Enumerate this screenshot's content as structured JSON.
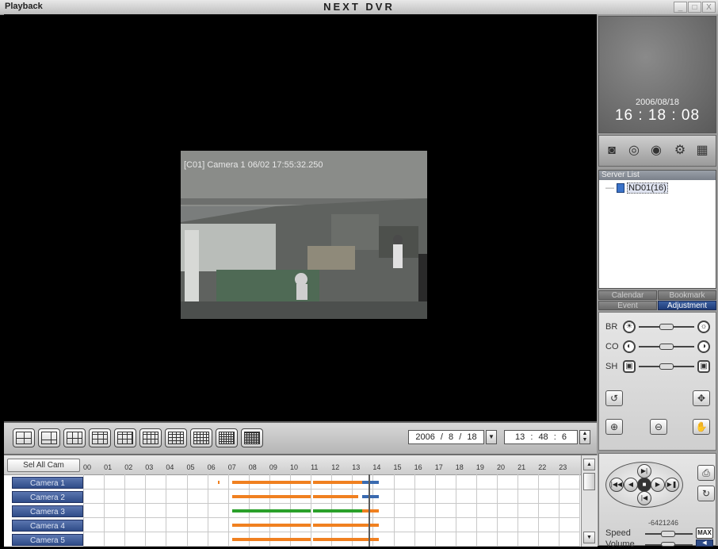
{
  "window": {
    "app_label": "Playback",
    "title": "NEXT DVR",
    "buttons": {
      "minimize": "_",
      "maximize": "□",
      "close": "X"
    }
  },
  "video": {
    "osd_text": "[C01] Camera 1 06/02 17:55:32.250"
  },
  "clock": {
    "date": "2006/08/18",
    "time": "16 : 18 : 08"
  },
  "toolbar_icons": [
    "camera-icon",
    "disk-icon",
    "disc-icon",
    "gear-icon",
    "film-icon"
  ],
  "server_list": {
    "header": "Server List",
    "items": [
      {
        "label": "ND01(16)"
      }
    ]
  },
  "tabs": {
    "calendar": "Calendar",
    "bookmark": "Bookmark",
    "event": "Event",
    "adjustment": "Adjustment",
    "active": "Adjustment"
  },
  "adjustment": {
    "rows": [
      {
        "label": "BR",
        "level": 0.5
      },
      {
        "label": "CO",
        "level": 0.5
      },
      {
        "label": "SH",
        "level": 0.5
      }
    ]
  },
  "playback": {
    "speed_label": "Speed",
    "speed_scale": "-6421246",
    "volume_label": "Volume",
    "max_label": "MAX"
  },
  "date_time_picker": {
    "year": "2006",
    "month": "8",
    "day": "18",
    "hour": "13",
    "minute": "48",
    "second": "6",
    "date_sep": "/",
    "time_sep": ":"
  },
  "timeline": {
    "select_all_label": "Sel All Cam",
    "hours": [
      "00",
      "01",
      "02",
      "03",
      "04",
      "05",
      "06",
      "07",
      "08",
      "09",
      "10",
      "11",
      "12",
      "13",
      "14",
      "15",
      "16",
      "17",
      "18",
      "19",
      "20",
      "21",
      "22",
      "23"
    ],
    "cameras": [
      "Camera 1",
      "Camera 2",
      "Camera 3",
      "Camera 4",
      "Camera 5"
    ],
    "colors": {
      "continuous": "#f08020",
      "motion": "#2aa02a",
      "event": "#3a6ab0",
      "accent": "#2f4c88"
    },
    "cursor_hour": 13.8
  }
}
